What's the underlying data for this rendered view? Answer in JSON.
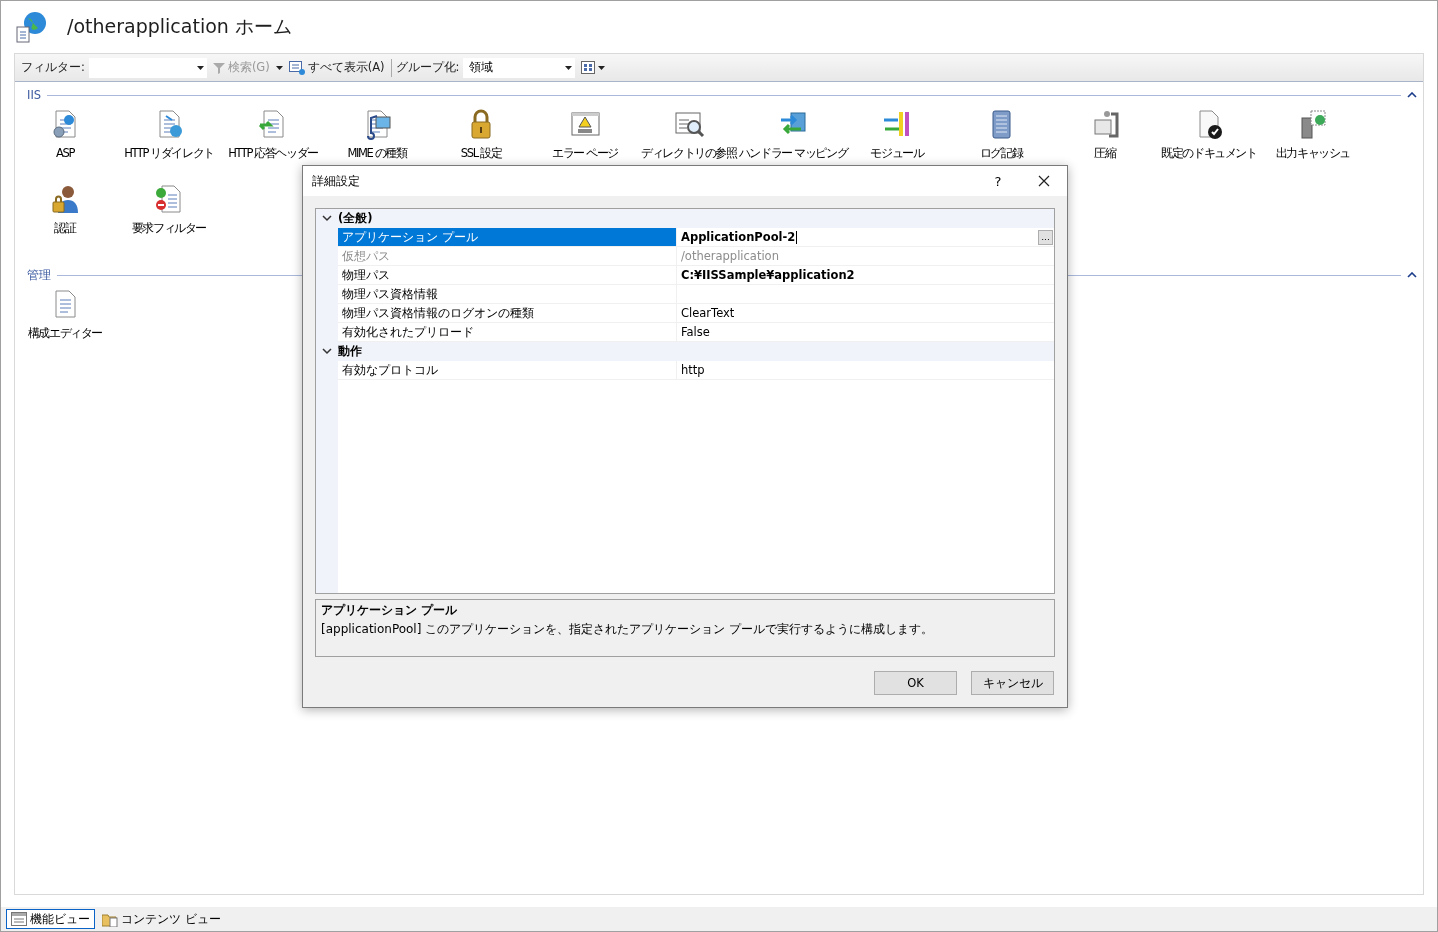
{
  "window": {
    "title": "/otherapplication ホーム"
  },
  "toolbar": {
    "filter_label": "フィルター:",
    "search_button": "検索(G)",
    "show_all_button": "すべて表示(A)",
    "group_label": "グループ化:",
    "group_value": "領域"
  },
  "groups": [
    {
      "title": "IIS",
      "expanded": true,
      "features": [
        {
          "label": "ASP"
        },
        {
          "label": "HTTP リダイレクト"
        },
        {
          "label": "HTTP 応答ヘッダー"
        },
        {
          "label": "MIME の種類"
        },
        {
          "label": "SSL 設定"
        },
        {
          "label": "エラー ページ"
        },
        {
          "label": "ディレクトリの参照"
        },
        {
          "label": "ハンドラー マッピング"
        },
        {
          "label": "モジュール"
        },
        {
          "label": "ログ記録"
        },
        {
          "label": "圧縮"
        },
        {
          "label": "既定のドキュメント"
        },
        {
          "label": "出力キャッシュ"
        },
        {
          "label": "認証"
        },
        {
          "label": "要求フィルター"
        }
      ]
    },
    {
      "title": "管理",
      "expanded": true,
      "features": [
        {
          "label": "構成エディター"
        }
      ]
    }
  ],
  "dialog": {
    "title": "詳細設定",
    "help": "?",
    "categories": [
      {
        "title": "(全般)",
        "expanded": true,
        "properties": [
          {
            "name": "アプリケーション プール",
            "value": "ApplicationPool-2",
            "selected": true,
            "disabled": false,
            "modified": true,
            "browse_button": "..."
          },
          {
            "name": "仮想パス",
            "value": "/otherapplication",
            "selected": false,
            "disabled": true,
            "modified": false
          },
          {
            "name": "物理パス",
            "value": "C:¥IISSample¥application2",
            "selected": false,
            "disabled": false,
            "modified": true
          },
          {
            "name": "物理パス資格情報",
            "selected": false,
            "disabled": false
          },
          {
            "name": "物理パス資格情報のログオンの種類",
            "value": "ClearText",
            "selected": false,
            "disabled": false,
            "modified": false
          },
          {
            "name": "有効化されたプリロード",
            "value": "False",
            "selected": false,
            "disabled": false,
            "modified": false
          }
        ]
      },
      {
        "title": "動作",
        "expanded": true,
        "properties": [
          {
            "name": "有効なプロトコル",
            "value": "http",
            "selected": false,
            "disabled": false,
            "modified": false
          }
        ]
      }
    ],
    "description": {
      "title": "アプリケーション プール",
      "text": "[applicationPool] このアプリケーションを、指定されたアプリケーション プールで実行するように構成します。"
    },
    "buttons": [
      "OK",
      "キャンセル"
    ]
  },
  "view_tabs": [
    {
      "label": "機能ビュー",
      "selected": true
    },
    {
      "label": "コンテンツ ビュー",
      "selected": false
    }
  ]
}
